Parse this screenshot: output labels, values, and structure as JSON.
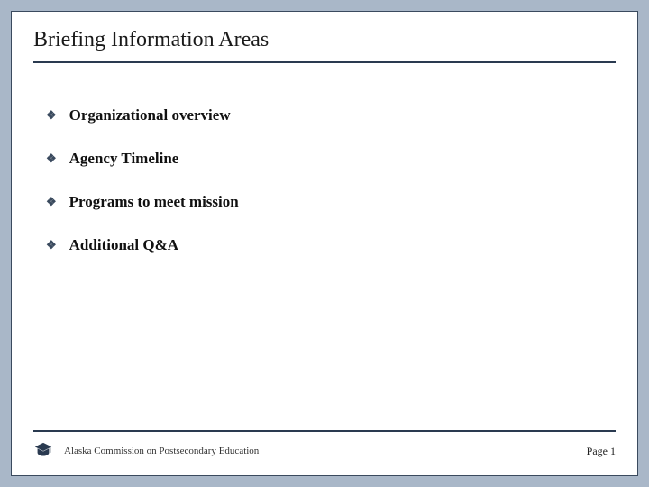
{
  "title": "Briefing Information Areas",
  "bullets": [
    "Organizational overview",
    "Agency Timeline",
    "Programs to meet mission",
    "Additional Q&A"
  ],
  "footer": {
    "org": "Alaska Commission on Postsecondary Education",
    "page_label": "Page 1"
  }
}
